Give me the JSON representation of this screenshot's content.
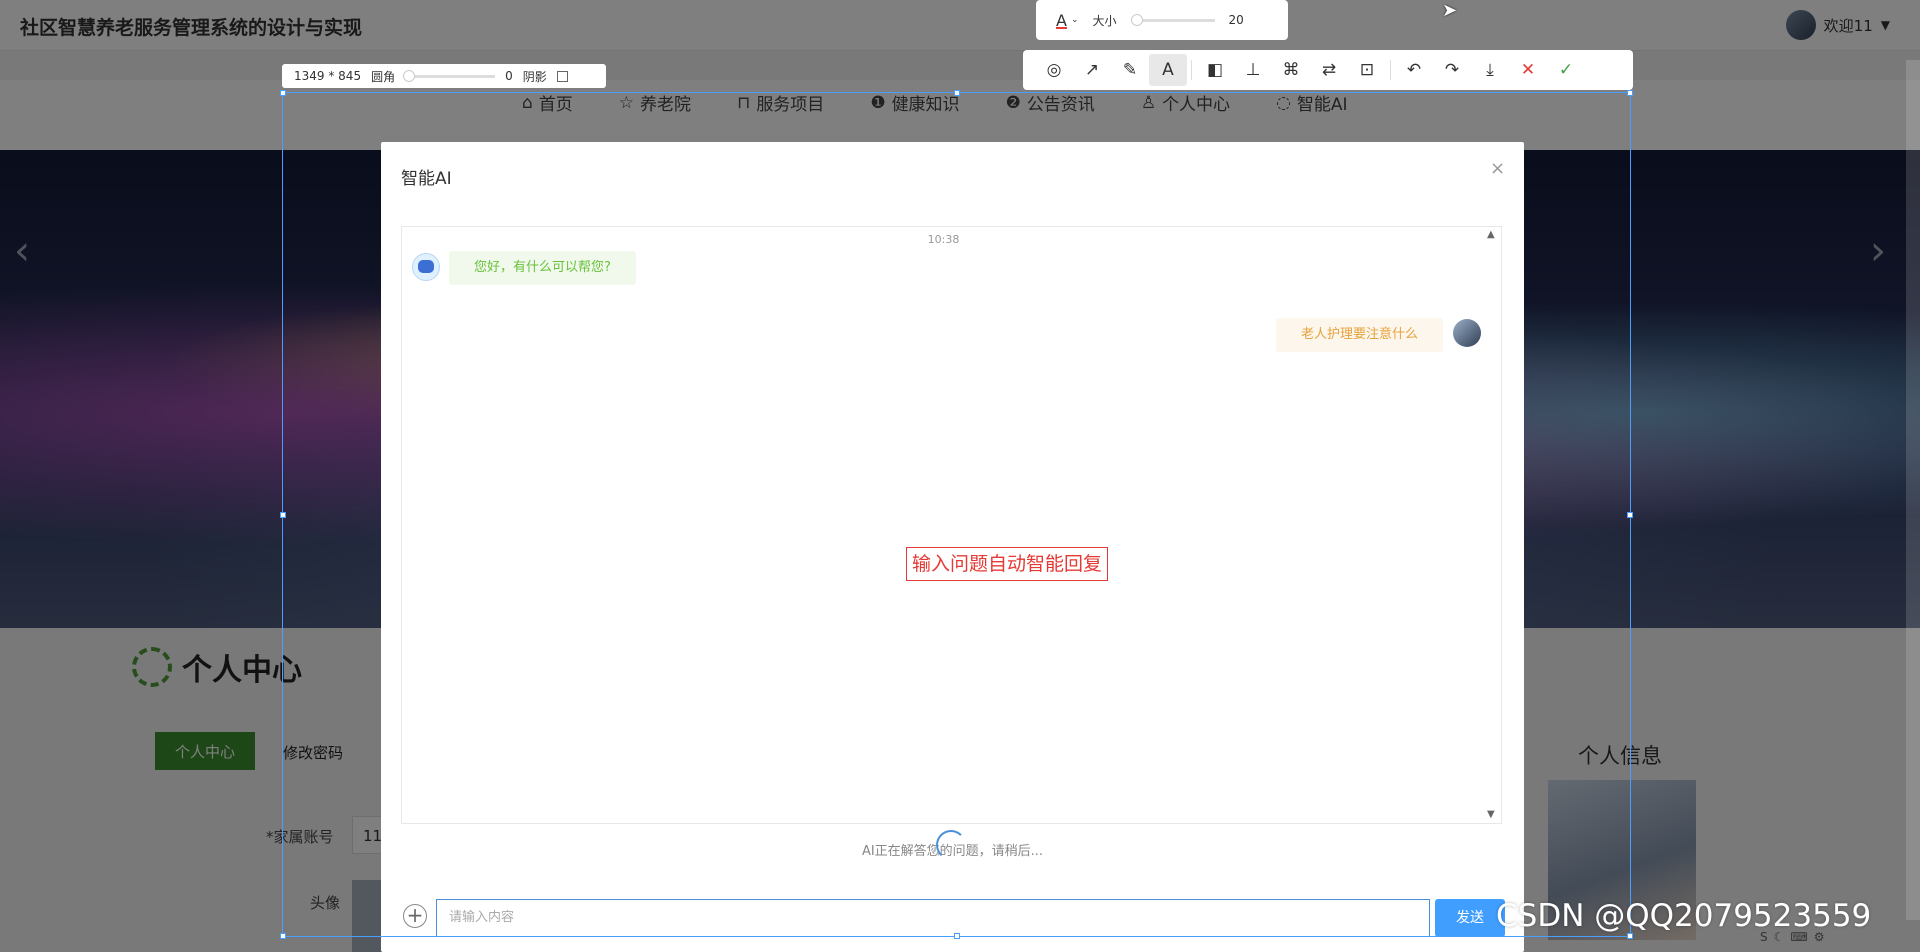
{
  "app": {
    "title": "社区智慧养老服务管理系统的设计与实现",
    "welcome": "欢迎11"
  },
  "nav": [
    {
      "icon": "home-icon",
      "glyph": "⌂",
      "label": "首页"
    },
    {
      "icon": "star-icon",
      "glyph": "☆",
      "label": "养老院"
    },
    {
      "icon": "bag-icon",
      "glyph": "⊓",
      "label": "服务项目"
    },
    {
      "icon": "alert-icon",
      "glyph": "❶",
      "label": "健康知识"
    },
    {
      "icon": "question-icon",
      "glyph": "❷",
      "label": "公告资讯"
    },
    {
      "icon": "user-icon",
      "glyph": "♙",
      "label": "个人中心"
    },
    {
      "icon": "chat-icon",
      "glyph": "◌",
      "label": "智能AI"
    }
  ],
  "page": {
    "section_title": "个人中心",
    "tab_active": "个人中心",
    "tab_other": "修改密码",
    "field_account_label": "*家属账号",
    "field_account_value": "11",
    "field_avatar_label": "头像",
    "info_title": "个人信息"
  },
  "dialog": {
    "title": "智能AI",
    "close": "×",
    "time": "10:38",
    "bot_message": "您好，有什么可以帮您?",
    "user_message": "老人护理要注意什么",
    "annotation": "输入问题自动智能回复",
    "loading": "AI正在解答您的问题，请稍后...",
    "input_placeholder": "请输入内容",
    "send": "发送",
    "plus": "+"
  },
  "screenshot_tool": {
    "dimensions": "1349 * 845",
    "radius_label": "圆角",
    "radius_value": "0",
    "shadow_label": "阴影",
    "size_label": "大小",
    "size_value": "20",
    "font_glyph": "A",
    "tools": [
      {
        "name": "shape-tool-icon",
        "glyph": "◎"
      },
      {
        "name": "arrow-tool-icon",
        "glyph": "↗"
      },
      {
        "name": "pen-tool-icon",
        "glyph": "✎"
      },
      {
        "name": "text-tool-icon",
        "glyph": "A",
        "active": true
      },
      {
        "name": "mosaic-tool-icon",
        "glyph": "◧"
      },
      {
        "name": "pin-tool-icon",
        "glyph": "⊥"
      },
      {
        "name": "ocr-tool-icon",
        "glyph": "⌘"
      },
      {
        "name": "translate-tool-icon",
        "glyph": "⇄"
      },
      {
        "name": "scan-tool-icon",
        "glyph": "⊡"
      },
      {
        "name": "undo-icon",
        "glyph": "↶"
      },
      {
        "name": "redo-icon",
        "glyph": "↷"
      },
      {
        "name": "download-icon",
        "glyph": "⤓"
      },
      {
        "name": "cancel-icon",
        "glyph": "✕",
        "color": "#e53935"
      },
      {
        "name": "confirm-icon",
        "glyph": "✓",
        "color": "#43a047"
      }
    ]
  },
  "watermark": "CSDN @QQ2079523559"
}
